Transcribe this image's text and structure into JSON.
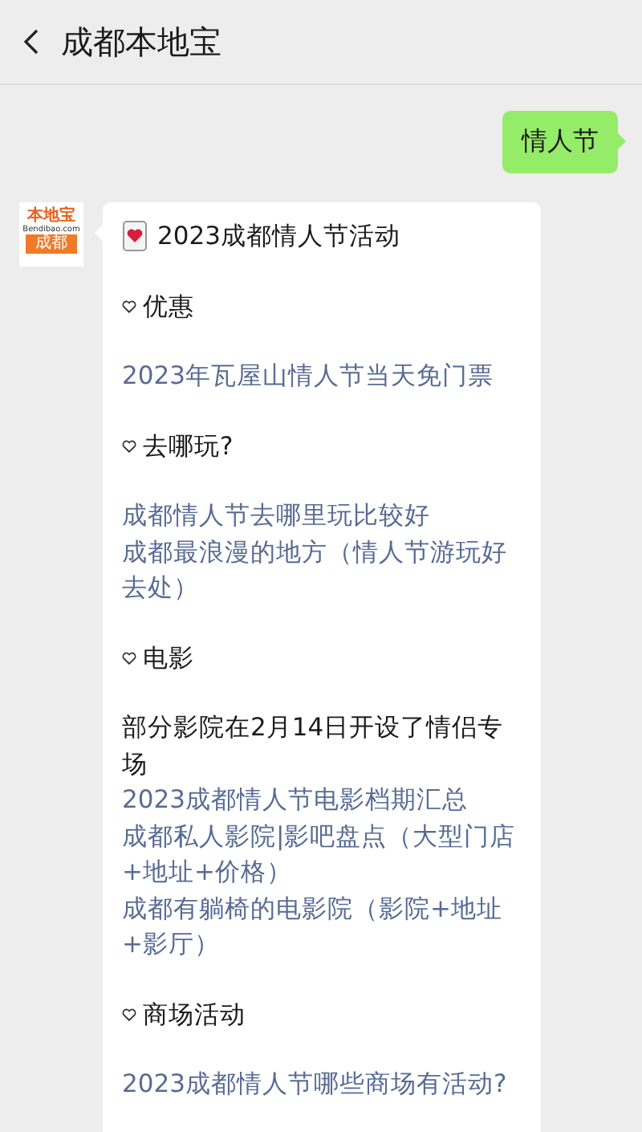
{
  "header": {
    "title": "成都本地宝"
  },
  "messages": [
    {
      "kind": "sent",
      "text": "情人节"
    },
    {
      "kind": "received",
      "avatar": {
        "brand": "本地宝",
        "domain": "Bendibao.com",
        "city": "成都"
      },
      "blocks": [
        [
          {
            "kind": "title",
            "text": "2023成都情人节活动"
          }
        ],
        [
          {
            "kind": "heading",
            "text": "优惠"
          }
        ],
        [
          {
            "kind": "link",
            "text": "2023年瓦屋山情人节当天免门票"
          }
        ],
        [
          {
            "kind": "heading",
            "text": "去哪玩?"
          }
        ],
        [
          {
            "kind": "link",
            "text": "成都情人节去哪里玩比较好"
          },
          {
            "kind": "link",
            "text": "成都最浪漫的地方（情人节游玩好去处）"
          }
        ],
        [
          {
            "kind": "heading",
            "text": "电影"
          }
        ],
        [
          {
            "kind": "text",
            "text": "部分影院在2月14日开设了情侣专场"
          },
          {
            "kind": "link",
            "text": "2023成都情人节电影档期汇总"
          },
          {
            "kind": "link",
            "text": "成都私人影院|影吧盘点（大型门店+地址+价格）"
          },
          {
            "kind": "link",
            "text": "成都有躺椅的电影院（影院+地址+影厅）"
          }
        ],
        [
          {
            "kind": "heading",
            "text": "商场活动"
          }
        ],
        [
          {
            "kind": "link",
            "text": "2023成都情人节哪些商场有活动?"
          }
        ]
      ]
    }
  ]
}
